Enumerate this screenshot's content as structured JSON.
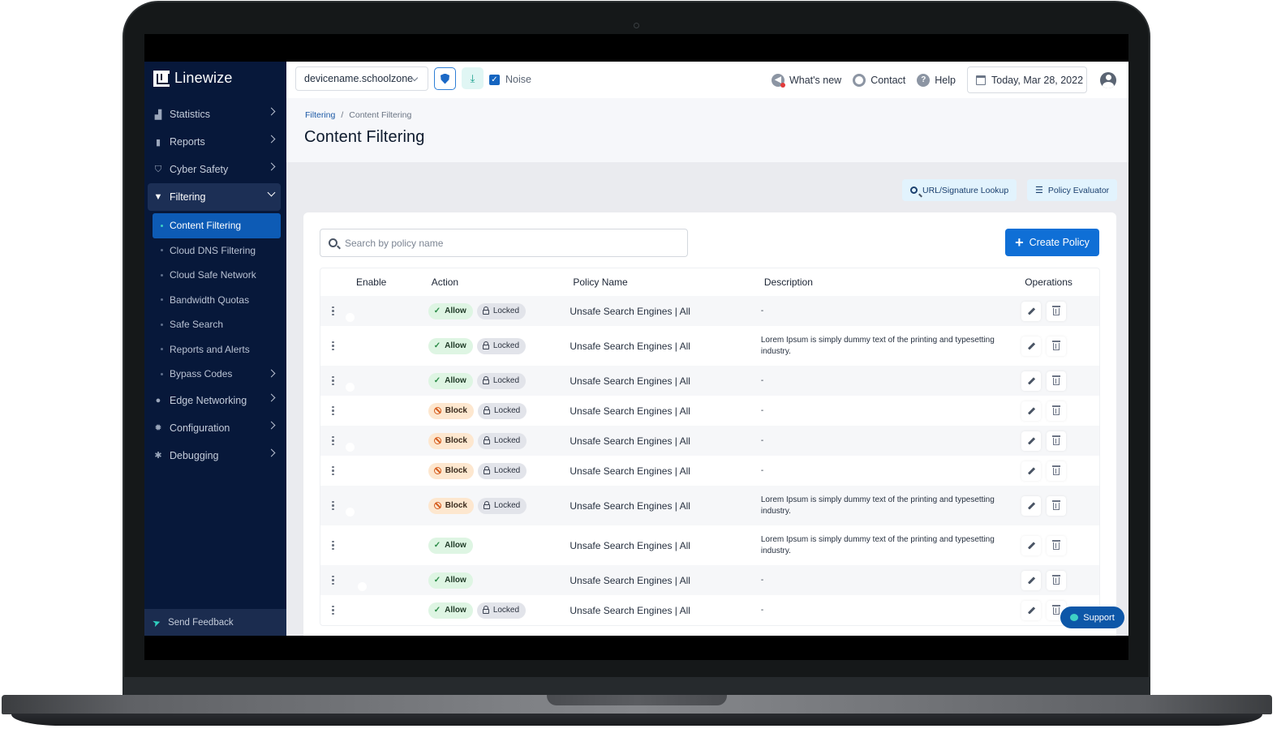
{
  "brand": {
    "name": "Linewize",
    "accent": "#0f6fd6",
    "sidebar_bg": "#07183a"
  },
  "sidebar": {
    "items": [
      {
        "label": "Statistics",
        "icon": "chart-icon",
        "has_children": true
      },
      {
        "label": "Reports",
        "icon": "document-icon",
        "has_children": true
      },
      {
        "label": "Cyber Safety",
        "icon": "shield-icon",
        "has_children": true
      },
      {
        "label": "Filtering",
        "icon": "filter-icon",
        "has_children": true,
        "expanded": true,
        "children": [
          {
            "label": "Content Filtering",
            "active": true
          },
          {
            "label": "Cloud DNS Filtering"
          },
          {
            "label": "Cloud Safe Network"
          },
          {
            "label": "Bandwidth Quotas"
          },
          {
            "label": "Safe Search"
          },
          {
            "label": "Reports and Alerts"
          },
          {
            "label": "Bypass Codes",
            "has_children": true
          }
        ]
      },
      {
        "label": "Edge Networking",
        "icon": "globe-icon",
        "has_children": true
      },
      {
        "label": "Configuration",
        "icon": "gear-icon",
        "has_children": true
      },
      {
        "label": "Debugging",
        "icon": "bug-icon",
        "has_children": true
      }
    ],
    "feedback_label": "Send Feedback"
  },
  "topbar": {
    "device": "devicename.schoolzone",
    "noise_label": "Noise",
    "noise_checked": true,
    "whats_new": "What's new",
    "contact": "Contact",
    "help": "Help",
    "date": "Today, Mar 28, 2022"
  },
  "header": {
    "breadcrumb": [
      "Filtering",
      "Content Filtering"
    ],
    "title": "Content Filtering"
  },
  "tools": {
    "lookup": "URL/Signature Lookup",
    "evaluator": "Policy Evaluator"
  },
  "search": {
    "placeholder": "Search by policy name",
    "value": ""
  },
  "create_button": "Create Policy",
  "table": {
    "columns": [
      "Enable",
      "Action",
      "Policy Name",
      "Description",
      "Operations"
    ],
    "rows": [
      {
        "enabled": true,
        "action": "Allow",
        "locked": true,
        "name": "Unsafe Search Engines | All",
        "description": "-"
      },
      {
        "enabled": true,
        "action": "Allow",
        "locked": true,
        "name": "Unsafe Search Engines | All",
        "description": "Lorem Ipsum is simply dummy text of the printing and typesetting industry."
      },
      {
        "enabled": true,
        "action": "Allow",
        "locked": true,
        "name": "Unsafe Search Engines | All",
        "description": "-"
      },
      {
        "enabled": true,
        "action": "Block",
        "locked": true,
        "name": "Unsafe Search Engines | All",
        "description": "-"
      },
      {
        "enabled": true,
        "action": "Block",
        "locked": true,
        "name": "Unsafe Search Engines | All",
        "description": "-"
      },
      {
        "enabled": true,
        "action": "Block",
        "locked": true,
        "name": "Unsafe Search Engines | All",
        "description": "-"
      },
      {
        "enabled": true,
        "action": "Block",
        "locked": true,
        "name": "Unsafe Search Engines | All",
        "description": "Lorem Ipsum is simply dummy text of the printing and typesetting industry."
      },
      {
        "enabled": false,
        "action": "Allow",
        "locked": false,
        "name": "Unsafe Search Engines | All",
        "description": "Lorem Ipsum is simply dummy text of the printing and typesetting industry."
      },
      {
        "enabled": false,
        "action": "Allow",
        "locked": false,
        "name": "Unsafe Search Engines | All",
        "description": "-"
      },
      {
        "enabled": true,
        "action": "Allow",
        "locked": true,
        "name": "Unsafe Search Engines | All",
        "description": "-"
      }
    ],
    "locked_label": "Locked"
  },
  "support_label": "Support"
}
